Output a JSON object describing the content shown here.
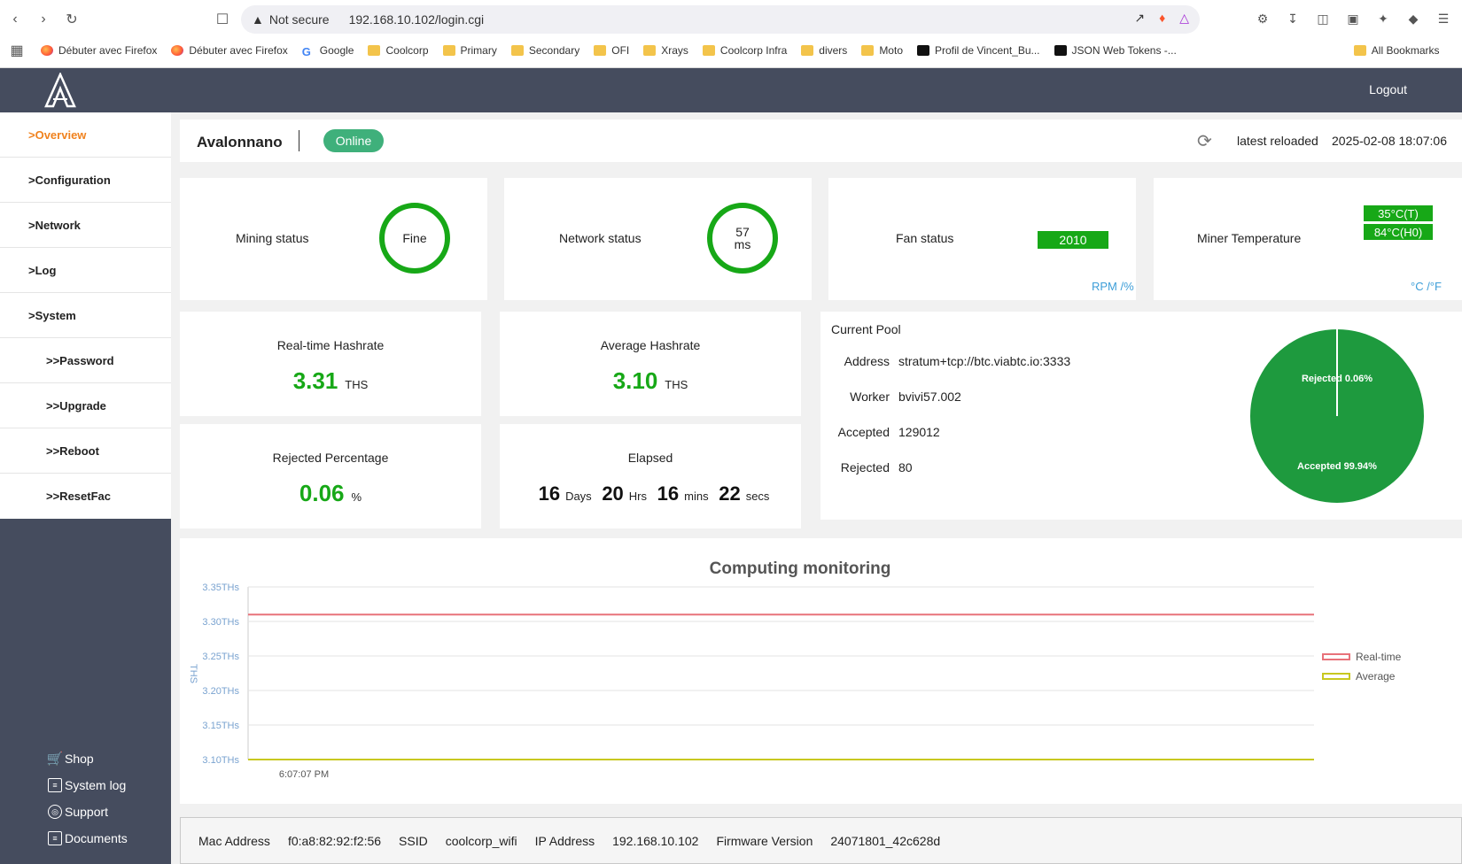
{
  "browser": {
    "security": "Not secure",
    "url": "192.168.10.102/login.cgi",
    "bookmarks": [
      "Débuter avec Firefox",
      "Débuter avec Firefox",
      "Google",
      "Coolcorp",
      "Primary",
      "Secondary",
      "OFI",
      "Xrays",
      "Coolcorp Infra",
      "divers",
      "Moto",
      "Profil de Vincent_Bu...",
      "JSON Web Tokens -...",
      "All Bookmarks"
    ]
  },
  "header": {
    "logout": "Logout"
  },
  "sidebar": {
    "items": [
      {
        "label": ">Overview",
        "active": true
      },
      {
        "label": ">Configuration"
      },
      {
        "label": ">Network"
      },
      {
        "label": ">Log"
      },
      {
        "label": ">System"
      },
      {
        "label": ">>Password"
      },
      {
        "label": ">>Upgrade"
      },
      {
        "label": ">>Reboot"
      },
      {
        "label": ">>ResetFac"
      }
    ],
    "links": [
      "Shop",
      "System log",
      "Support",
      "Documents"
    ]
  },
  "device": {
    "name": "Avalonnano",
    "status": "Online",
    "reload_label": "latest reloaded",
    "reload_time": "2025-02-08 18:07:06"
  },
  "status": {
    "mining_label": "Mining status",
    "mining_value": "Fine",
    "network_label": "Network status",
    "network_value": "57",
    "network_unit": "ms",
    "fan_label": "Fan status",
    "fan_value": "2010",
    "fan_unit": "RPM /%",
    "temp_label": "Miner Temperature",
    "temp_t": "35°C(T)",
    "temp_h": "84°C(H0)",
    "temp_unit": "°C /°F"
  },
  "hashrate": {
    "realtime_label": "Real-time Hashrate",
    "realtime_value": "3.31",
    "average_label": "Average Hashrate",
    "average_value": "3.10",
    "unit": "THS",
    "rejected_label": "Rejected Percentage",
    "rejected_value": "0.06",
    "rejected_unit": "%",
    "elapsed_label": "Elapsed",
    "days": "16",
    "days_unit": "Days",
    "hrs": "20",
    "hrs_unit": "Hrs",
    "mins": "16",
    "mins_unit": "mins",
    "secs": "22",
    "secs_unit": "secs"
  },
  "pool": {
    "title": "Current Pool",
    "address_label": "Address",
    "address": "stratum+tcp://btc.viabtc.io:3333",
    "worker_label": "Worker",
    "worker": "bvivi57.002",
    "accepted_label": "Accepted",
    "accepted": "129012",
    "rejected_label": "Rejected",
    "rejected": "80",
    "pie_rejected": "Rejected 0.06%",
    "pie_accepted": "Accepted 99.94%",
    "rejected_pct": 0.06,
    "accepted_pct": 99.94,
    "accepted_color": "#1e9a3e"
  },
  "chart_data": {
    "type": "line",
    "title": "Computing monitoring",
    "ylabel": "THS",
    "x": [
      "6:07:07 PM"
    ],
    "yticks": [
      "3.10THs",
      "3.15THs",
      "3.20THs",
      "3.25THs",
      "3.30THs",
      "3.35THs"
    ],
    "ylim": [
      3.1,
      3.35
    ],
    "grid": true,
    "legend": "right",
    "series": [
      {
        "name": "Real-time",
        "values": [
          3.31,
          3.31
        ],
        "color": "#e8727a"
      },
      {
        "name": "Average",
        "values": [
          3.1,
          3.1
        ],
        "color": "#c8c820"
      }
    ]
  },
  "footer": {
    "mac_label": "Mac Address",
    "mac": "f0:a8:82:92:f2:56",
    "ssid_label": "SSID",
    "ssid": "coolcorp_wifi",
    "ip_label": "IP Address",
    "ip": "192.168.10.102",
    "fw_label": "Firmware Version",
    "fw": "24071801_42c628d"
  }
}
